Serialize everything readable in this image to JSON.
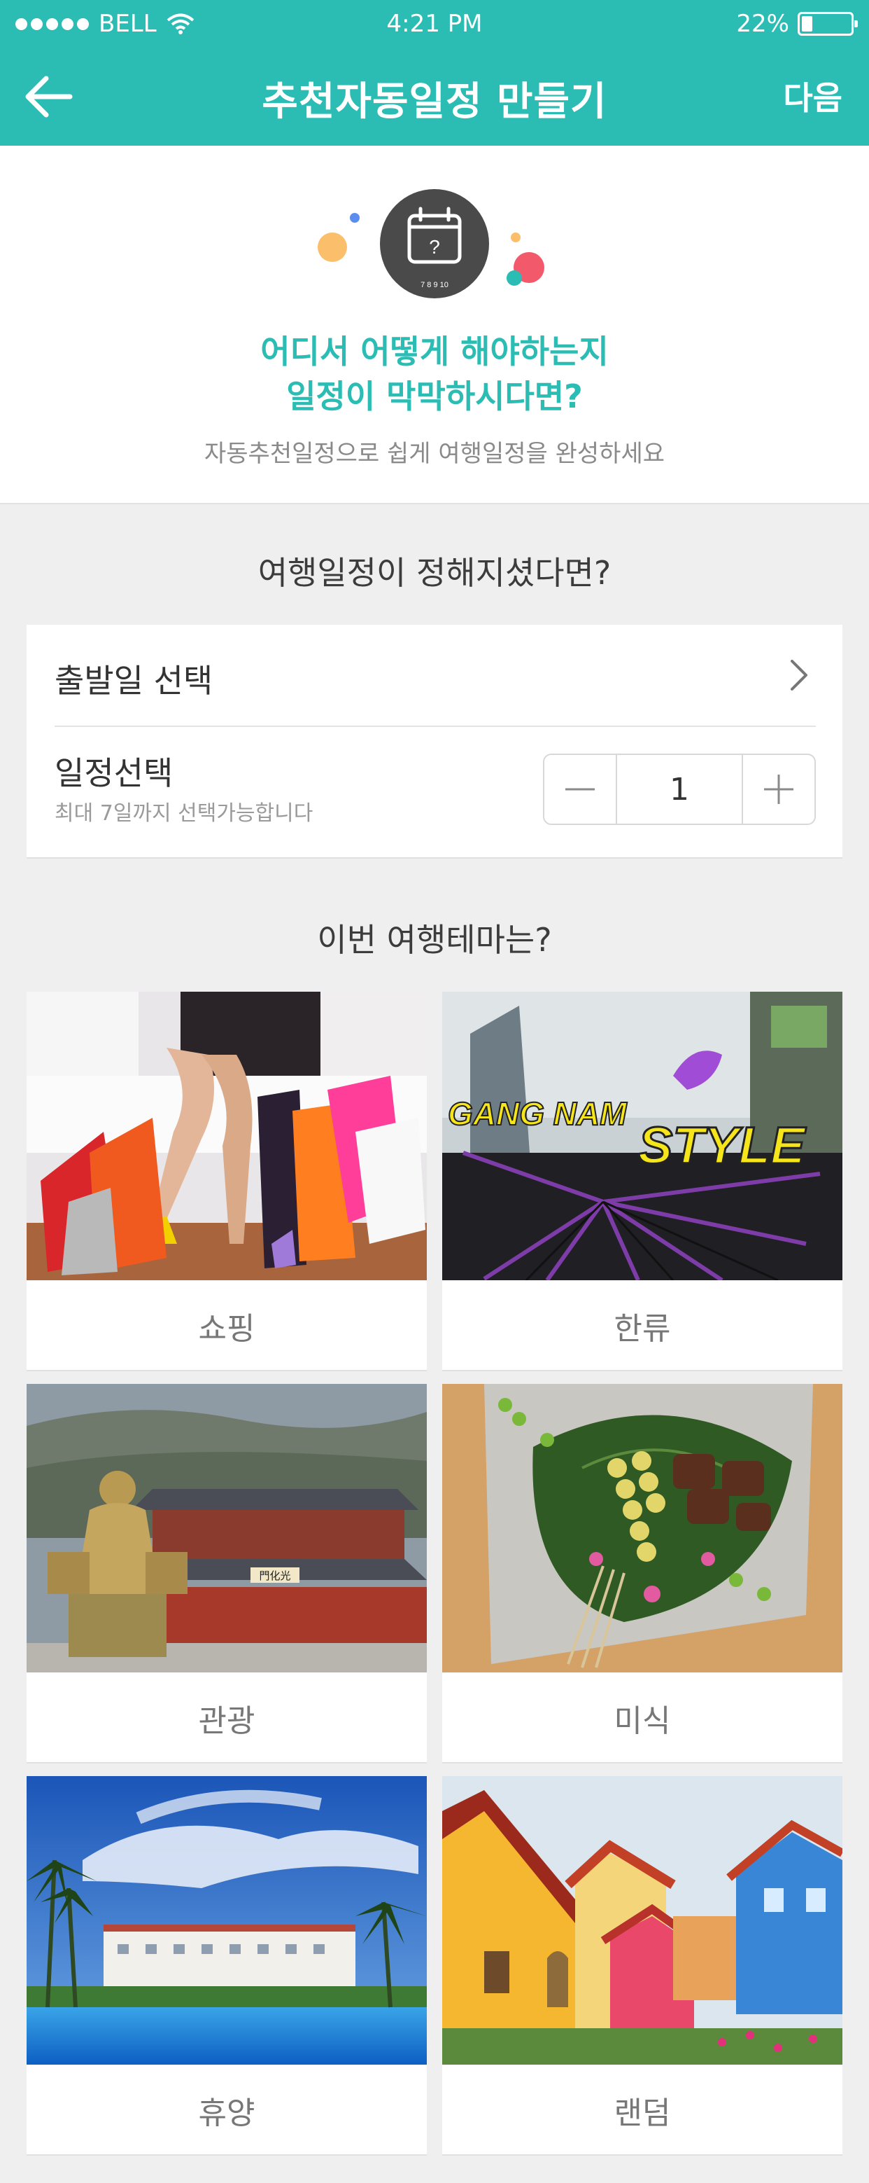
{
  "status_bar": {
    "carrier": "BELL",
    "time": "4:21 PM",
    "battery": "22%",
    "battery_level": 0.22
  },
  "navbar": {
    "title": "추천자동일정 만들기",
    "next_label": "다음"
  },
  "intro": {
    "question_line1": "어디서 어떻게 해야하는지",
    "question_line2": "일정이 막막하시다면?",
    "subtitle": "자동추천일정으로 쉽게 여행일정을 완성하세요",
    "calendar_days": "7 8 9 10",
    "accent_color": "#2bbcb4"
  },
  "schedule": {
    "section_title": "여행일정이 정해지셨다면?",
    "departure_label": "출발일 선택",
    "duration_label": "일정선택",
    "duration_hint": "최대 7일까지 선택가능합니다",
    "duration_value": "1"
  },
  "themes": {
    "section_title": "이번 여행테마는?",
    "items": [
      {
        "label": "쇼핑"
      },
      {
        "label": "한류",
        "sign_line1": "GANG NAM",
        "sign_line2": "STYLE"
      },
      {
        "label": "관광",
        "gate_sign": "門化光"
      },
      {
        "label": "미식"
      },
      {
        "label": "휴양"
      },
      {
        "label": "랜덤"
      }
    ]
  }
}
